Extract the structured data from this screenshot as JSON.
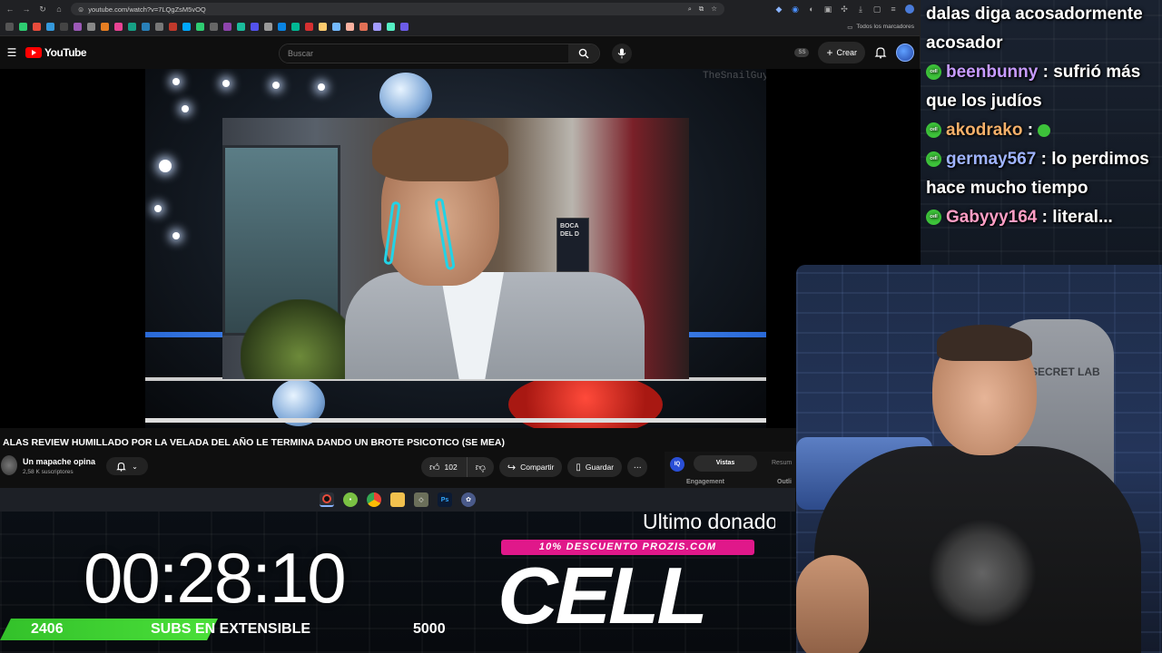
{
  "browser": {
    "url": "youtube.com/watch?v=7LQgZsM5vOQ",
    "bookmarks_folder": "Todos los marcadores"
  },
  "youtube": {
    "logo": "YouTube",
    "search_placeholder": "Buscar",
    "badge": "SS",
    "create_label": "Crear",
    "video_watermark": "TheSnailGuy",
    "inset_sign": "BOCA DEL D"
  },
  "video": {
    "title": "ALAS REVIEW HUMILLADO POR LA VELADA DEL AÑO LE TERMINA DANDO UN BROTE PSICOTICO (SE MEA)",
    "channel": "Un mapache opina",
    "subscribers": "2,58 K suscriptores",
    "likes": "102",
    "share_label": "Compartir",
    "save_label": "Guardar"
  },
  "extension": {
    "logo": "IQ",
    "tab_active": "Vistas",
    "tab_inactive": "Resum",
    "label_left": "Engagement",
    "label_right": "Outli"
  },
  "overlay": {
    "timer": "00:28:10",
    "subs_current": "2406",
    "subs_label": "SUBS EN EXTENSIBLE",
    "subs_goal": "5000",
    "subs_progress": 0.48,
    "last_donation_label": "Ultimo donador",
    "promo": "10% DESCUENTO PROZIS.COM",
    "donor_name": "CELL"
  },
  "chat": [
    {
      "user": "",
      "message": "dalas diga acosadormente acosador"
    },
    {
      "user": "beenbunny",
      "message": "sufrió más que los judíos"
    },
    {
      "user": "akodrako",
      "message": ""
    },
    {
      "user": "germay567",
      "message": "lo perdimos hace mucho tiempo"
    },
    {
      "user": "Gabyyy164",
      "message": "literal..."
    }
  ],
  "webcam": {
    "chair_brand": "SECRET LAB"
  },
  "colors": {
    "youtube_red": "#ff0000",
    "subs_green": "#3dc23a",
    "promo_pink": "#e0188a",
    "tear_cyan": "#22d3e6"
  }
}
